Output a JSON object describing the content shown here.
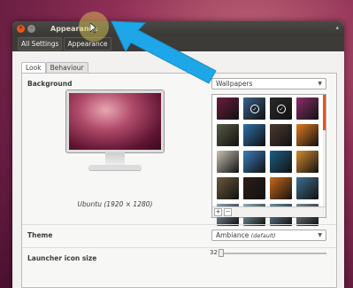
{
  "window": {
    "title": "Appearance",
    "close_glyph": "×",
    "minimize_glyph": "–",
    "maximize_glyph": "▴"
  },
  "navbar": {
    "all_settings": "All Settings",
    "current": "Appearance"
  },
  "tabs": [
    {
      "label": "Look",
      "active": true
    },
    {
      "label": "Behaviour",
      "active": false
    }
  ],
  "background": {
    "label": "Background",
    "dropdown_value": "Wallpapers",
    "caption": "Ubuntu (1920 × 1280)"
  },
  "wallpapers": [
    {
      "color": "#6a1d3f",
      "selected": false
    },
    {
      "color": "#3b5f8a",
      "selected": true
    },
    {
      "color": "#2a2a2a",
      "selected": true
    },
    {
      "color": "#8b2f6b",
      "selected": false
    },
    {
      "color": "#5a5a45",
      "selected": false
    },
    {
      "color": "#2f6fa8",
      "selected": false
    },
    {
      "color": "#4b3a30",
      "selected": false
    },
    {
      "color": "#e07a20",
      "selected": false
    },
    {
      "color": "#c9c2b3",
      "selected": false
    },
    {
      "color": "#3a7dbf",
      "selected": false
    },
    {
      "color": "#1d5f86",
      "selected": false
    },
    {
      "color": "#d48b30",
      "selected": false
    },
    {
      "color": "#6a5a3a",
      "selected": false
    },
    {
      "color": "#2d1c18",
      "selected": false
    },
    {
      "color": "#c96a1d",
      "selected": false
    },
    {
      "color": "#3e6f8f",
      "selected": false
    },
    {
      "color": "#8fa0b5",
      "selected": false
    },
    {
      "color": "#8ab0b8",
      "selected": false
    },
    {
      "color": "#6d8fa5",
      "selected": false
    },
    {
      "color": "#7a8a90",
      "selected": false
    }
  ],
  "grid_footer": {
    "add": "+",
    "remove": "−"
  },
  "theme": {
    "label": "Theme",
    "value": "Ambiance",
    "note": "(default)"
  },
  "launcher": {
    "label": "Launcher icon size",
    "value": "32"
  },
  "colors": {
    "accent": "#e95420",
    "arrow": "#1ea7e8"
  }
}
